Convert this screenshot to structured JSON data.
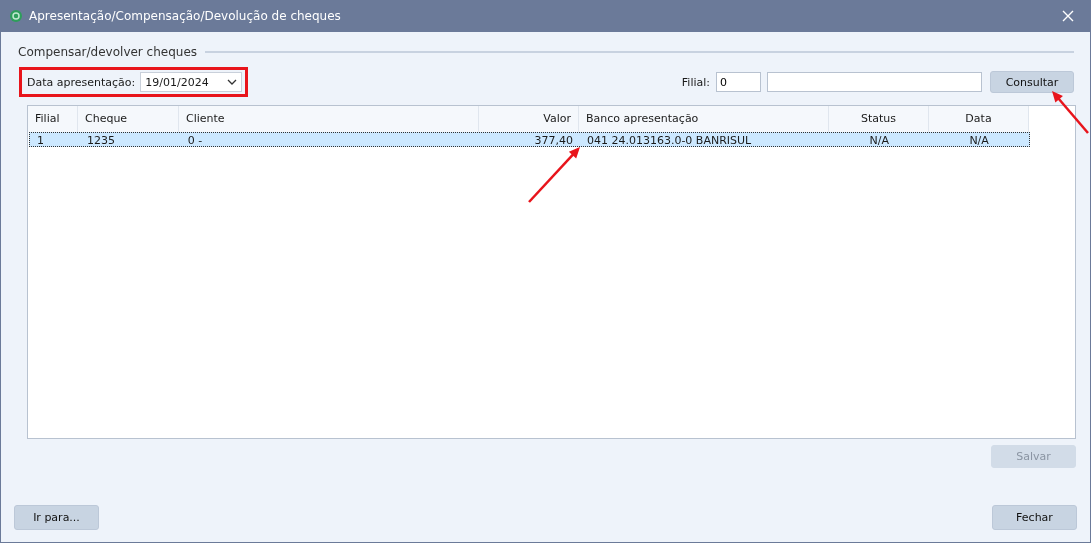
{
  "window": {
    "title": "Apresentação/Compensação/Devolução de cheques"
  },
  "group": {
    "title": "Compensar/devolver cheques"
  },
  "date_filter": {
    "label": "Data apresentação:",
    "value": "19/01/2024",
    "highlighted": true
  },
  "filial": {
    "label": "Filial:",
    "value": "0"
  },
  "consultar_button": {
    "label": "Consultar",
    "annotated": true
  },
  "table": {
    "columns": [
      {
        "label": "Filial"
      },
      {
        "label": "Cheque"
      },
      {
        "label": "Cliente"
      },
      {
        "label": "Valor"
      },
      {
        "label": "Banco apresentação"
      },
      {
        "label": "Status"
      },
      {
        "label": "Data"
      }
    ],
    "rows": [
      {
        "selected": true,
        "annotated": true,
        "cells": [
          "1",
          "1235",
          "0 -",
          "377,40",
          "041 24.013163.0-0 BANRISUL",
          "N/A",
          "N/A"
        ]
      }
    ]
  },
  "save_button": {
    "label": "Salvar",
    "disabled": true
  },
  "goto_button": {
    "label": "Ir para..."
  },
  "close_button": {
    "label": "Fechar"
  }
}
